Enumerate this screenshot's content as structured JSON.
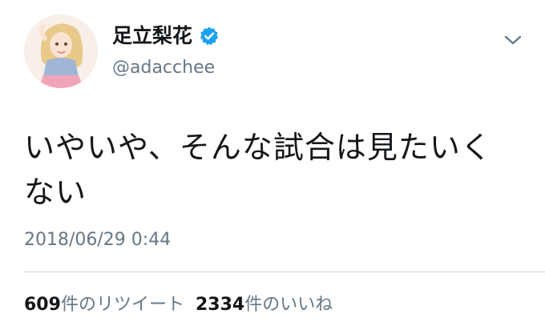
{
  "user": {
    "display_name": "足立梨花",
    "handle": "@adacchee",
    "verified": true,
    "avatar_icon": "avatar-illustration",
    "verified_color": "#1da1f2"
  },
  "tweet": {
    "text": "いやいや、そんな試合は見たいくない",
    "timestamp": "2018/06/29 0:44"
  },
  "stats": {
    "retweets_count": "609",
    "retweets_label": "件のリツイート",
    "likes_count": "2334",
    "likes_label": "件のいいね"
  },
  "menu": {
    "icon": "chevron-down-icon"
  }
}
